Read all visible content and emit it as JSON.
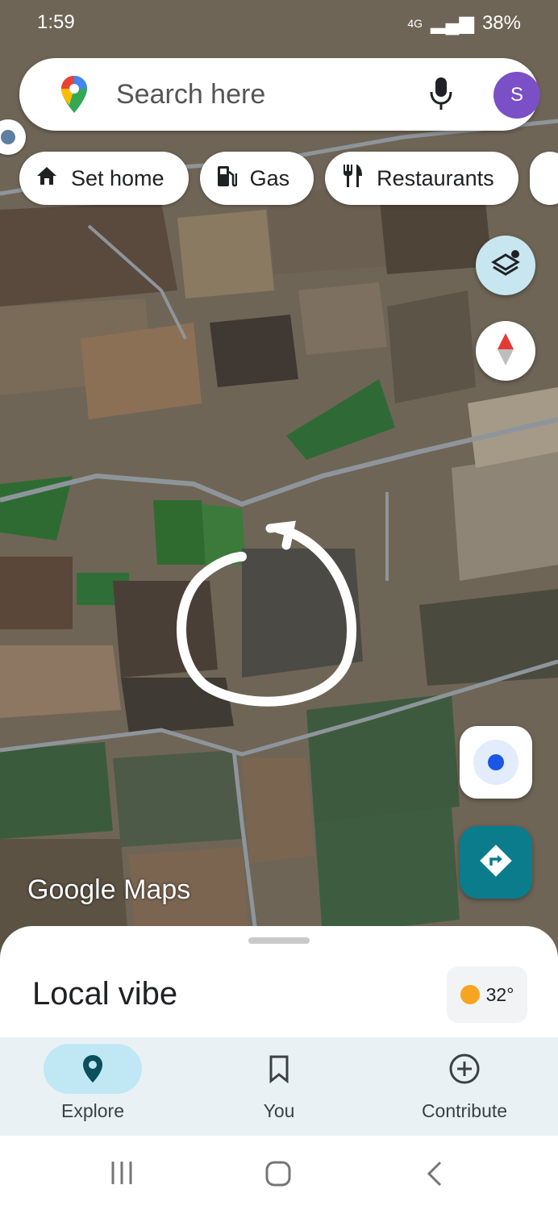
{
  "status_bar": {
    "time": "1:59",
    "battery": "38%",
    "network": "4G"
  },
  "search": {
    "placeholder": "Search here",
    "avatar_letter": "S"
  },
  "chips": [
    {
      "label": "Set home",
      "icon": "home-icon"
    },
    {
      "label": "Gas",
      "icon": "gas-station-icon"
    },
    {
      "label": "Restaurants",
      "icon": "restaurant-icon"
    }
  ],
  "map": {
    "watermark": "Google Maps",
    "style": "satellite",
    "annotation": "hand-drawn white circle"
  },
  "sheet": {
    "title": "Local vibe",
    "weather_temp": "32°"
  },
  "bottom_nav": [
    {
      "label": "Explore",
      "icon": "location-pin-icon",
      "active": true
    },
    {
      "label": "You",
      "icon": "bookmark-icon",
      "active": false
    },
    {
      "label": "Contribute",
      "icon": "add-circle-icon",
      "active": false
    }
  ],
  "colors": {
    "accent_teal": "#0b7c8c",
    "avatar_purple": "#7b4fc6",
    "active_nav": "#c0e8f4",
    "location_blue": "#1a57e8"
  }
}
